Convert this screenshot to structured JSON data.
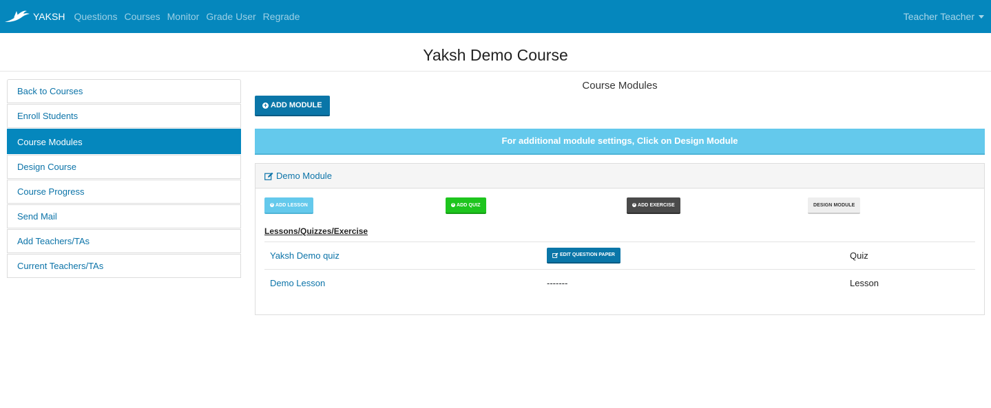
{
  "nav": {
    "brand": "YAKSH",
    "links": [
      "Questions",
      "Courses",
      "Monitor",
      "Grade User",
      "Regrade"
    ],
    "user": "Teacher Teacher"
  },
  "page": {
    "title": "Yaksh Demo Course"
  },
  "sidebar": {
    "items": [
      {
        "label": "Back to Courses"
      },
      {
        "label": "Enroll Students"
      },
      {
        "label": "Course Modules"
      },
      {
        "label": "Design Course"
      },
      {
        "label": "Course Progress"
      },
      {
        "label": "Send Mail"
      },
      {
        "label": "Add Teachers/TAs"
      },
      {
        "label": "Current Teachers/TAs"
      }
    ],
    "active_item": "Course Modules"
  },
  "main": {
    "heading": "Course Modules",
    "add_module_label": "ADD MODULE",
    "info_banner": "For additional module settings, Click on Design Module",
    "module": {
      "name": "Demo Module",
      "buttons": {
        "add_lesson": "ADD LESSON",
        "add_quiz": "ADD QUIZ",
        "add_exercise": "ADD EXERCISE",
        "design_module": "DESIGN MODULE"
      },
      "section_title": "Lessons/Quizzes/Exercise",
      "rows": [
        {
          "name": "Yaksh Demo quiz",
          "action": "EDIT QUESTION PAPER",
          "type": "Quiz"
        },
        {
          "name": "Demo Lesson",
          "action": "-------",
          "type": "Lesson"
        }
      ]
    }
  },
  "colors": {
    "navbar": "#0587bd",
    "primary": "#0a76a8",
    "info": "#64c9ec",
    "success": "#1ec51e",
    "dark": "#4a4a4a",
    "light": "#eeeeee"
  },
  "icons": {
    "brand": "bird-logo-icon",
    "plus": "plus-circle-icon",
    "edit": "edit-icon",
    "caret": "caret-down-icon"
  }
}
